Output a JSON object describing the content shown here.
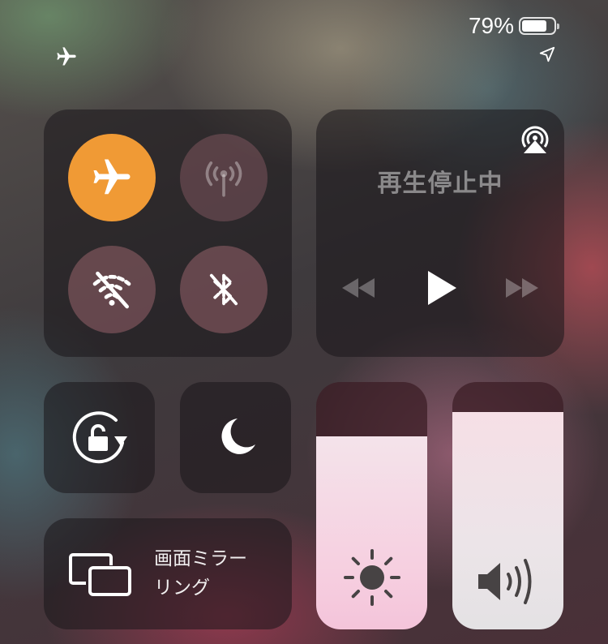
{
  "status_bar": {
    "battery_percent": "79%",
    "battery_level": 0.79,
    "icons": [
      "airplane-icon",
      "location-arrow-icon"
    ]
  },
  "connectivity": {
    "airplane_mode": {
      "icon": "airplane-icon",
      "on": true,
      "color": "#f09a35"
    },
    "cellular": {
      "icon": "cellular-antenna-icon",
      "on": false
    },
    "wifi": {
      "icon": "wifi-off-icon",
      "on": false
    },
    "bluetooth": {
      "icon": "bluetooth-off-icon",
      "on": false
    }
  },
  "media": {
    "status_text": "再生停止中",
    "airplay_icon": "airplay-audio-icon",
    "controls": [
      "rewind-icon",
      "play-icon",
      "fast-forward-icon"
    ]
  },
  "rotation_lock": {
    "icon": "rotation-lock-icon"
  },
  "do_not_disturb": {
    "icon": "moon-icon"
  },
  "screen_mirroring": {
    "icon": "screen-mirroring-icon",
    "label_line1": "画面ミラー",
    "label_line2": "リング"
  },
  "brightness": {
    "icon": "sun-icon",
    "level": 0.78
  },
  "volume": {
    "icon": "speaker-volume-icon",
    "level": 0.88
  }
}
